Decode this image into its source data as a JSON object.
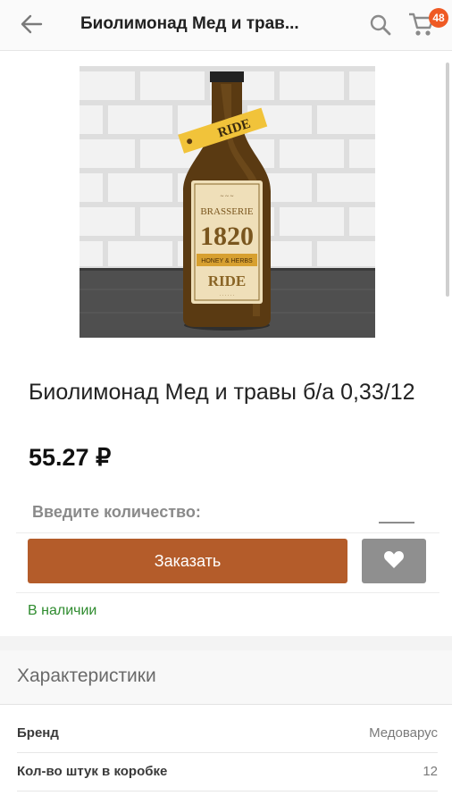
{
  "header": {
    "title": "Биолимонад Мед и трав...",
    "cart_count": "48"
  },
  "product": {
    "name": "Биолимонад Мед и травы  б/а 0,33/12",
    "price": "55.27 ₽",
    "label": {
      "brand_banner": "RIDE",
      "brasserie": "BRASSERIE",
      "year": "1820",
      "flavor": "HONEY & HERBS",
      "name": "RIDE"
    }
  },
  "order": {
    "quantity_label": "Введите количество:",
    "quantity_value": "",
    "order_button": "Заказать",
    "stock_status": "В наличии"
  },
  "characteristics": {
    "title": "Характеристики",
    "rows": [
      {
        "key": "Бренд",
        "value": "Медоварус"
      },
      {
        "key": "Кол-во штук в коробке",
        "value": "12"
      }
    ]
  },
  "colors": {
    "accent": "#b45c2a",
    "badge": "#ef5a24",
    "in_stock": "#2e8b2e"
  }
}
